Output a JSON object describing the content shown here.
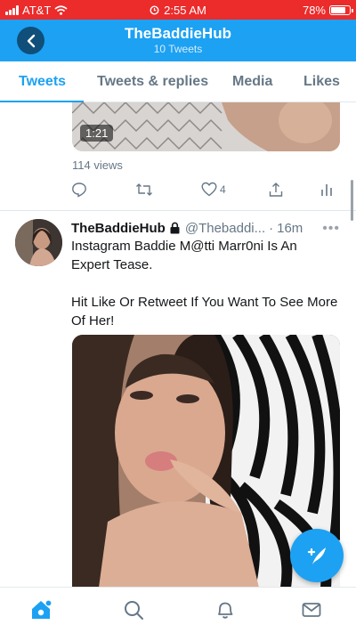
{
  "status_bar": {
    "carrier": "AT&T",
    "time": "2:55 AM",
    "battery": "78%",
    "battery_level": 0.78,
    "icons": [
      "signal-icon",
      "wifi-icon",
      "alarm-icon",
      "battery-icon"
    ]
  },
  "header": {
    "back_icon": "chevron-left-icon",
    "title": "TheBaddieHub",
    "subtitle": "10 Tweets"
  },
  "tabs": [
    {
      "label": "Tweets",
      "active": true
    },
    {
      "label": "Tweets & replies",
      "active": false
    },
    {
      "label": "Media",
      "active": false
    },
    {
      "label": "Likes",
      "active": false
    }
  ],
  "previous_tweet": {
    "video_duration": "1:21",
    "views": "114 views",
    "actions": {
      "reply_icon": "reply-icon",
      "retweet_icon": "retweet-icon",
      "like_icon": "heart-icon",
      "like_count": "4",
      "share_icon": "share-icon",
      "analytics_icon": "analytics-icon"
    }
  },
  "tweet": {
    "name": "TheBaddieHub",
    "lock_icon": "lock-icon",
    "handle": "@Thebaddi...",
    "separator": "·",
    "time": "16m",
    "more_icon": "more-icon",
    "text_lines": [
      "Instagram Baddie M@tti Marr0ni Is An Expert Tease.",
      "Hit Like Or Retweet If You Want To See More Of Her!"
    ]
  },
  "fab": {
    "icon": "compose-icon"
  },
  "bottom_nav": [
    {
      "icon": "home-icon",
      "active": true
    },
    {
      "icon": "search-icon",
      "active": false
    },
    {
      "icon": "notifications-icon",
      "active": false
    },
    {
      "icon": "messages-icon",
      "active": false
    }
  ],
  "colors": {
    "status_bar": "#ec2b2b",
    "header": "#1da1f2",
    "accent": "#1da1f2",
    "secondary_text": "#657786"
  }
}
